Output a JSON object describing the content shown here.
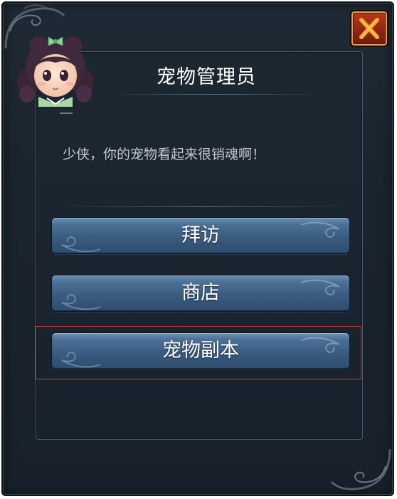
{
  "dialog": {
    "title": "宠物管理员",
    "message": "少侠，你的宠物看起来很销魂啊！",
    "buttons": [
      {
        "label": "拜访"
      },
      {
        "label": "商店"
      },
      {
        "label": "宠物副本"
      }
    ],
    "highlighted_button": "宠物副本"
  },
  "icons": {
    "close": "close-x-icon",
    "avatar": "npc-girl-portrait"
  },
  "colors": {
    "frame_background": "#1b2530",
    "button_blue": "#3a5c80",
    "close_red": "#9a2a14",
    "close_x_orange": "#f5a623",
    "highlight_red": "#c43a3a",
    "title_text": "#ffffff",
    "message_text": "#c2c9d2"
  }
}
